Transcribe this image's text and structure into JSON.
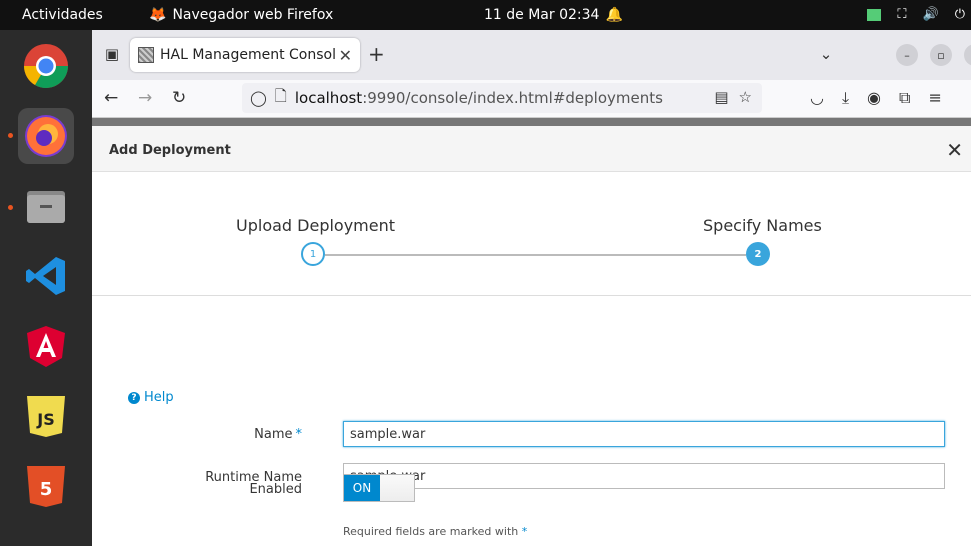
{
  "topbar": {
    "activities": "Actividades",
    "app_name": "Navegador web Firefox",
    "clock": "11 de Mar  02:34"
  },
  "dock": {
    "apps": [
      "chrome-icon",
      "firefox-icon",
      "files-icon",
      "vscode-icon",
      "angular-icon",
      "javascript-icon",
      "html5-icon"
    ]
  },
  "browser": {
    "tab_title": "HAL Management Consol",
    "url_host": "localhost",
    "url_path": ":9990/console/index.html#deployments"
  },
  "modal": {
    "title": "Add Deployment",
    "steps": [
      {
        "label": "Upload Deployment",
        "number": "1"
      },
      {
        "label": "Specify Names",
        "number": "2"
      }
    ],
    "help_label": "Help",
    "fields": {
      "name_label": "Name",
      "name_value": "sample.war",
      "runtime_label": "Runtime Name",
      "runtime_value": "sample.war",
      "enabled_label": "Enabled",
      "enabled_value": "ON"
    },
    "required_note": "Required fields are marked with",
    "required_marker": "*"
  },
  "colors": {
    "accent": "#39a5dc",
    "link": "#0088ce",
    "toggle_on": "#0088ce"
  }
}
